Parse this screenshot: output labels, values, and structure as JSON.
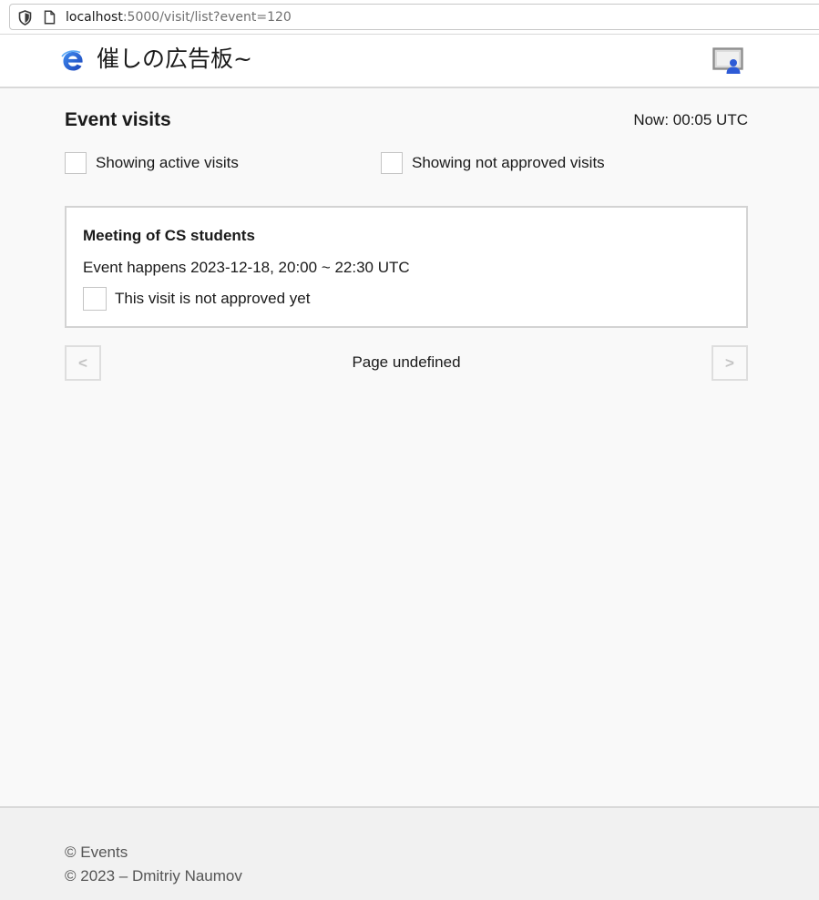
{
  "browser": {
    "url_host": "localhost",
    "url_path": ":5000/visit/list?event=120",
    "shield_icon": "shield-icon",
    "page_icon": "page-icon"
  },
  "header": {
    "title": "催しの広告板~",
    "logo_icon": "e-logo-icon",
    "avatar_icon": "user-avatar-icon"
  },
  "page": {
    "title": "Event visits",
    "now": "Now: 00:05 UTC"
  },
  "filters": {
    "active_label": "Showing active visits",
    "active_checked": false,
    "approved_label": "Showing not approved visits",
    "approved_checked": false
  },
  "visits": [
    {
      "event_name": "Meeting of CS students",
      "time": "Event happens 2023-12-18, 20:00 ~ 22:30 UTC",
      "approval_label": "This visit is not approved yet",
      "approved": false
    }
  ],
  "pager": {
    "prev_label": "<",
    "next_label": ">",
    "page_label": "Page undefined"
  },
  "footer": {
    "line1": "© Events",
    "line2": "© 2023 – Dmitriy Naumov"
  },
  "colors": {
    "logo_blue": "#1e5ed6",
    "avatar_blue": "#2e5bd6",
    "card_border": "#d3d3d3",
    "background": "#f9f9f9"
  }
}
